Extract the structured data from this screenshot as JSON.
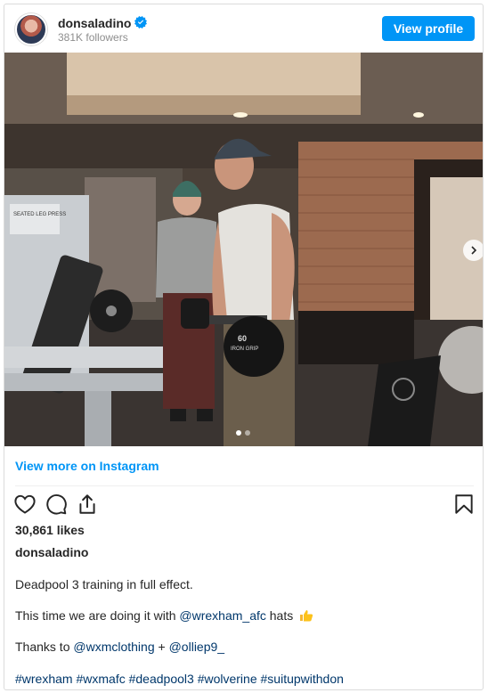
{
  "header": {
    "username": "donsaladino",
    "followers": "381K followers",
    "view_profile_label": "View profile"
  },
  "media": {
    "description": "Instagram carousel photo",
    "carousel_slide": 1,
    "carousel_total": 2,
    "equipment_labels": {
      "machine_sign": "SEATED LEG PRESS",
      "dumbbell_weight": "60",
      "dumbbell_brand": "IRON GRIP"
    }
  },
  "view_more_label": "View more on Instagram",
  "actions": {
    "icons": [
      "heart-icon",
      "comment-icon",
      "share-icon",
      "bookmark-icon"
    ]
  },
  "likes": "30,861 likes",
  "caption": {
    "username": "donsaladino",
    "line1": "Deadpool 3 training in full effect.",
    "line2_prefix": "This time we are doing it with ",
    "line2_mention": "@wrexham_afc",
    "line2_suffix": " hats",
    "line3_prefix": "Thanks to ",
    "line3_mention1": "@wxmclothing",
    "line3_sep": " + ",
    "line3_mention2": "@olliep9_",
    "hashtags": [
      "#wrexham",
      "#wxmafc",
      "#deadpool3",
      "#wolverine",
      "#suitupwithdon"
    ]
  },
  "colors": {
    "accent": "#0095f6",
    "link": "#00376b",
    "text": "#262626",
    "muted": "#8e8e8e"
  }
}
